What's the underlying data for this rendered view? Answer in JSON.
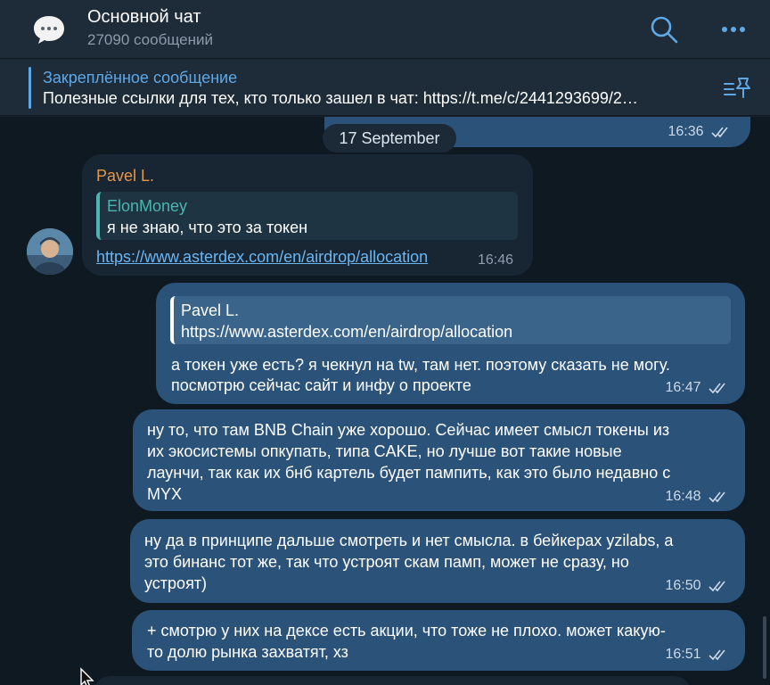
{
  "header": {
    "title": "Основной чат",
    "subtitle": "27090 сообщений"
  },
  "pinned": {
    "title": "Закреплённое сообщение",
    "text": "Полезные ссылки для тех, кто только зашел в чат:  https://t.me/c/2441293699/2…"
  },
  "chat": {
    "top_partial_time": "16:36",
    "date_separator": "17 September",
    "incoming": {
      "sender": "Pavel L.",
      "reply_author": "ElonMoney",
      "reply_text": "я не знаю, что это за токен",
      "link": "https://www.asterdex.com/en/airdrop/allocation",
      "time": "16:46"
    },
    "outgoing": [
      {
        "reply_author": "Pavel L.",
        "reply_text": "https://www.asterdex.com/en/airdrop/allocation",
        "lines": [
          "а токен уже есть? я чекнул на tw, там нет. поэтому сказать не могу.",
          "посмотрю сейчас сайт и инфу о проекте"
        ],
        "time": "16:47"
      },
      {
        "lines": [
          "ну то, что там BNB Chain уже хорошо. Сейчас имеет смысл токены из",
          "их экосистемы опкупать, типа CAKE, но лучше вот такие новые",
          "лаунчи, так как их бнб картель будет пампить, как это было недавно с",
          "MYX"
        ],
        "time": "16:48"
      },
      {
        "lines": [
          "ну да в принципе дальше смотреть и нет смысла. в бейкерах yzilabs, а",
          "это бинанс тот же, так что устроят скам памп, может не сразу, но",
          "устроят)"
        ],
        "time": "16:50"
      },
      {
        "lines": [
          "+ смотрю у них на дексе есть акции, что тоже не плохо. может какую-",
          "то долю рынка захватят, хз"
        ],
        "time": "16:51"
      }
    ]
  },
  "colors": {
    "outgoing_bubble": "#2b5278",
    "incoming_bubble": "#182533",
    "accent": "#5fa8e6",
    "sender_name": "#e3974a",
    "reply_teal": "#4cb5b0"
  }
}
